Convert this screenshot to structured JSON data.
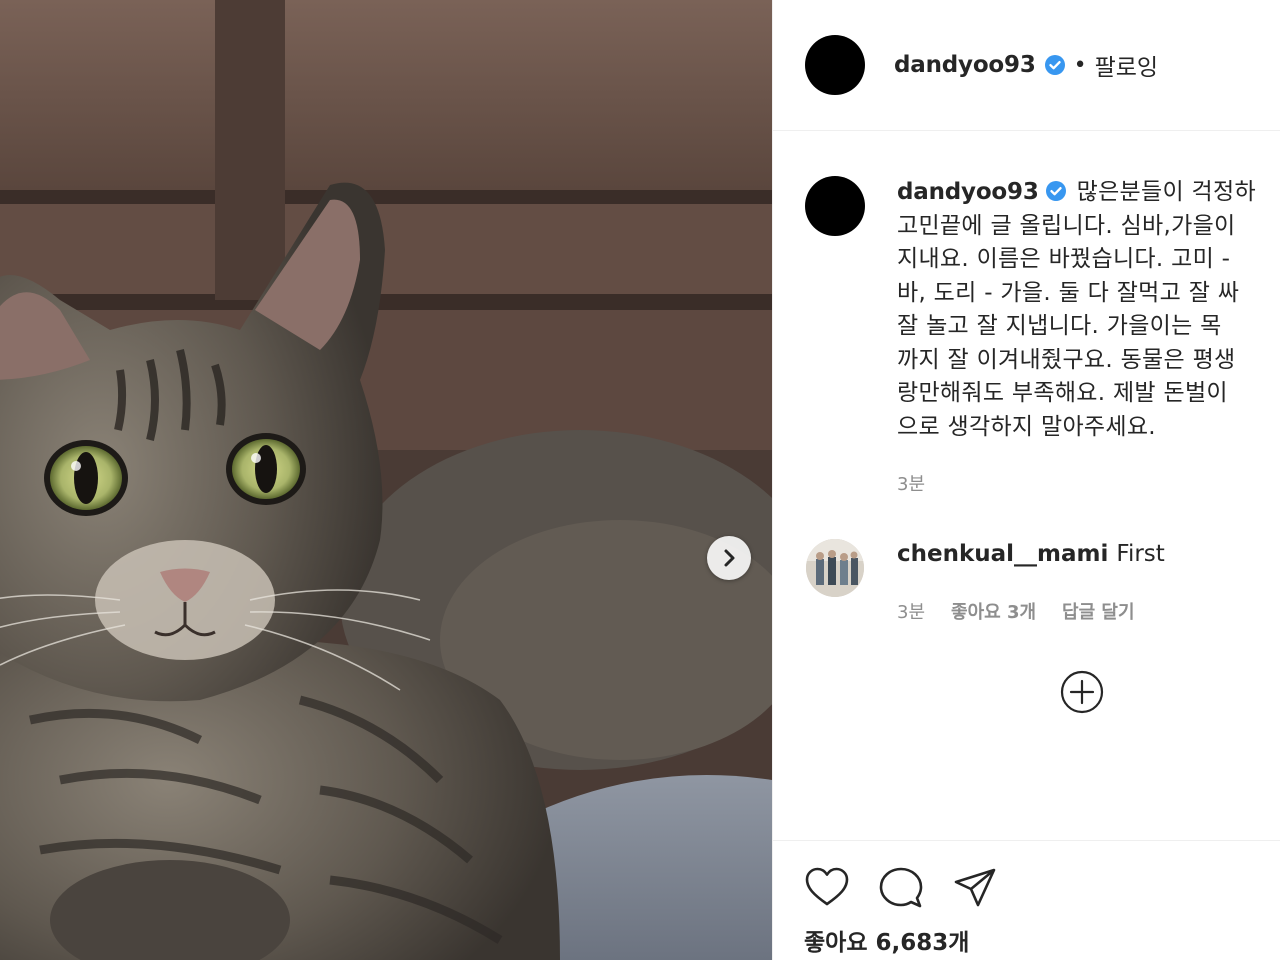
{
  "post": {
    "username": "dandyoo93",
    "follow_separator": "•",
    "follow_status": "팔로잉"
  },
  "caption": {
    "username": "dandyoo93",
    "lines": [
      "많은분들이 걱정하",
      "고민끝에 글 올립니다. 심바,가을이",
      "지내요. 이름은 바꿨습니다. 고미 -",
      "바, 도리 - 가을. 둘 다 잘먹고 잘 싸",
      "잘 놀고 잘 지냅니다. 가을이는 목",
      "까지 잘 이겨내줬구요. 동물은 평생",
      "랑만해줘도 부족해요. 제발 돈벌이",
      "으로 생각하지 말아주세요."
    ],
    "time": "3분"
  },
  "comment": {
    "username": "chenkual__mami",
    "text": "First",
    "time": "3분",
    "likes": "좋아요 3개",
    "reply": "답글 달기"
  },
  "likes_count": "좋아요 6,683개",
  "icons": {
    "verified": "verified-badge-icon",
    "next": "chevron-right-icon",
    "load_more": "plus-circle-icon",
    "like": "heart-icon",
    "comment": "comment-bubble-icon",
    "share": "paper-plane-icon"
  },
  "colors": {
    "verified": "#3897f0",
    "text": "#262626",
    "muted": "#8e8e8e",
    "divider": "#efefef"
  }
}
